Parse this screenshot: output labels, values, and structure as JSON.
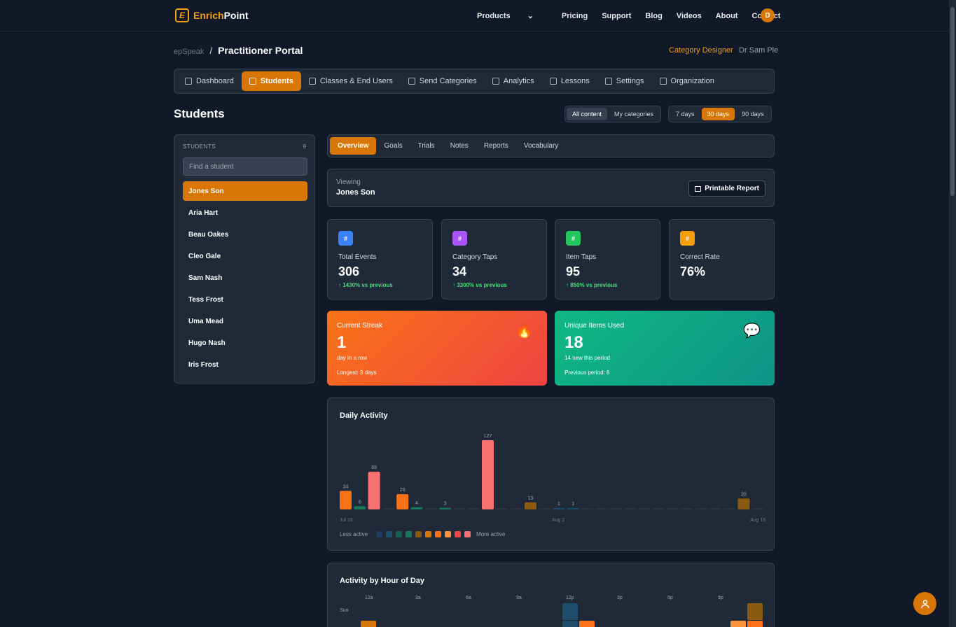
{
  "brand": {
    "mark": "E",
    "name_a": "Enrich",
    "name_b": "Point"
  },
  "nav": {
    "items": [
      "Products",
      "Pricing",
      "Support",
      "Blog",
      "Videos",
      "About",
      "Contact"
    ],
    "avatar": "D"
  },
  "breadcrumb": {
    "app": "epSpeak",
    "sep": "/",
    "page": "Practitioner Portal"
  },
  "header": {
    "role": "Category Designer",
    "user": "Dr Sam Ple"
  },
  "tabs": [
    "Dashboard",
    "Students",
    "Classes & End Users",
    "Send Categories",
    "Analytics",
    "Lessons",
    "Settings",
    "Organization"
  ],
  "page_title": "Students",
  "content_filter": [
    "All content",
    "My categories"
  ],
  "range_filter": [
    "7 days",
    "30 days",
    "90 days"
  ],
  "students": {
    "header": "STUDENTS",
    "count": "9",
    "search_placeholder": "Find a student",
    "items": [
      "Jones Son",
      "Aria Hart",
      "Beau Oakes",
      "Cleo Gale",
      "Sam Nash",
      "Tess Frost",
      "Uma Mead",
      "Hugo Nash",
      "Iris Frost"
    ]
  },
  "subtabs": [
    "Overview",
    "Goals",
    "Trials",
    "Notes",
    "Reports",
    "Vocabulary"
  ],
  "viewing": {
    "label": "Viewing",
    "name": "Jones Son",
    "print": "Printable Report"
  },
  "stats": [
    {
      "icon": "#",
      "color": "#3b82f6",
      "label": "Total Events",
      "value": "306",
      "trend": "↑ 1430% vs previous"
    },
    {
      "icon": "#",
      "color": "#a855f7",
      "label": "Category Taps",
      "value": "34",
      "trend": "↑ 3300% vs previous"
    },
    {
      "icon": "#",
      "color": "#22c55e",
      "label": "Item Taps",
      "value": "95",
      "trend": "↑ 850% vs previous"
    },
    {
      "icon": "#",
      "color": "#f59e0b",
      "label": "Correct Rate",
      "value": "76%",
      "trend": ""
    }
  ],
  "streak": {
    "label": "Current Streak",
    "value": "1",
    "sub": "day in a row",
    "note": "Longest: 3 days",
    "icon": "🔥"
  },
  "unique": {
    "label": "Unique Items Used",
    "value": "18",
    "sub": "14 new this period",
    "note": "Previous period: 6",
    "icon": "💬"
  },
  "daily_activity": {
    "title": "Daily Activity",
    "x_start": "Jul 18",
    "x_mid": "Aug 2",
    "x_end": "Aug 16",
    "legend_less": "Less active",
    "legend_more": "More active",
    "legend_colors": [
      "#1e3a5f",
      "#1e4d6b",
      "#15614f",
      "#17785a",
      "#8a5a10",
      "#d97706",
      "#f97316",
      "#fb923c",
      "#ef4444",
      "#f87171"
    ]
  },
  "chart_data": {
    "type": "bar",
    "title": "Daily Activity",
    "categories": [
      "Jul 18",
      "Jul 19",
      "Jul 20",
      "Jul 21",
      "Jul 22",
      "Jul 23",
      "Jul 24",
      "Jul 25",
      "Jul 26",
      "Jul 27",
      "Jul 28",
      "Jul 29",
      "Jul 30",
      "Jul 31",
      "Aug 1",
      "Aug 2",
      "Aug 3",
      "Aug 4",
      "Aug 5",
      "Aug 6",
      "Aug 7",
      "Aug 8",
      "Aug 9",
      "Aug 10",
      "Aug 11",
      "Aug 12",
      "Aug 13",
      "Aug 14",
      "Aug 15",
      "Aug 16"
    ],
    "values": [
      34,
      6,
      69,
      0,
      28,
      4,
      0,
      3,
      0,
      0,
      127,
      0,
      0,
      13,
      0,
      1,
      1,
      0,
      0,
      0,
      0,
      0,
      0,
      0,
      0,
      0,
      0,
      0,
      20,
      0
    ],
    "ylim": [
      0,
      127
    ]
  },
  "hour_activity": {
    "title": "Activity by Hour of Day",
    "hours": [
      "12a",
      "3a",
      "6a",
      "9a",
      "12p",
      "3p",
      "6p",
      "9p"
    ],
    "days": [
      "Sun"
    ]
  },
  "fab_icon": "person-icon"
}
